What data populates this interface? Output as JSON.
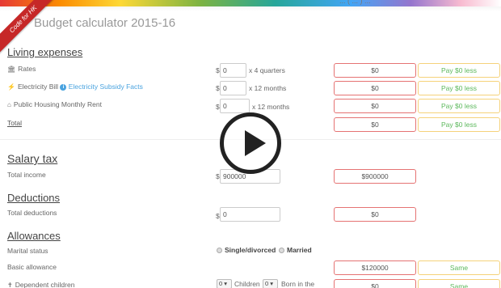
{
  "top_snippet": "... ( ... ) ...",
  "ribbon_text": "Code for HK",
  "title": "Budget calculator 2015-16",
  "living": {
    "heading": "Living expenses",
    "rates": {
      "label": "Rates",
      "value": "0",
      "suffix": "x 4 quarters",
      "result": "$0",
      "compare": "Pay $0 less"
    },
    "electricity": {
      "label": "Electricity Bill",
      "link": "Electricity Subsidy Facts",
      "value": "0",
      "suffix": "x 12 months",
      "result": "$0",
      "compare": "Pay $0 less"
    },
    "rent": {
      "label": "Public Housing Monthly Rent",
      "value": "0",
      "suffix": "x 12 months",
      "result": "$0",
      "compare": "Pay $0 less"
    },
    "total": {
      "label": "Total",
      "result": "$0",
      "compare": "Pay $0 less"
    }
  },
  "salary": {
    "heading": "Salary tax",
    "income": {
      "label": "Total income",
      "value": "900000",
      "result": "$900000"
    }
  },
  "deductions": {
    "heading": "Deductions",
    "total": {
      "label": "Total deductions",
      "value": "0",
      "result": "$0"
    }
  },
  "allowances": {
    "heading": "Allowances",
    "marital": {
      "label": "Marital status",
      "option1": "Single/divorced",
      "option2": "Married",
      "selected": "Single/divorced"
    },
    "basic": {
      "label": "Basic allowance",
      "result": "$120000",
      "compare": "Same"
    },
    "children": {
      "label": "Dependent children",
      "count": "0",
      "children_text": "Children",
      "born_count": "0",
      "born_text": "Born in the",
      "result": "$0",
      "compare": "Same"
    }
  },
  "currency": "$",
  "icons": {
    "rates": "bank-icon",
    "electricity": "bolt-icon",
    "rent": "home-icon",
    "children": "child-icon",
    "video": "play-icon"
  },
  "colors": {
    "result_border": "#e57373",
    "compare_border": "#f5d27a",
    "compare_text": "#5cb85c",
    "link": "#4aa3df"
  }
}
